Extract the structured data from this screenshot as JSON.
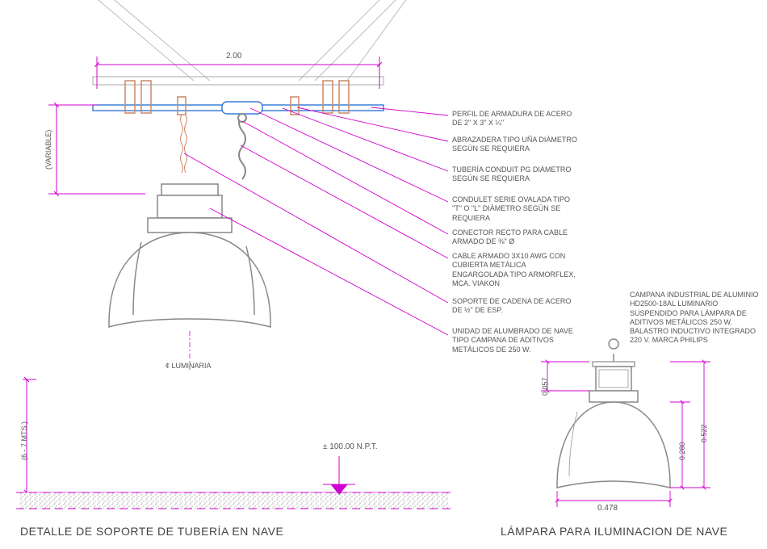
{
  "titles": {
    "left": "DETALLE DE SOPORTE DE TUBERÍA EN NAVE",
    "right": "LÁMPARA PARA ILUMINACION DE NAVE"
  },
  "dims": {
    "span": "2.00",
    "variable": "(VARIABLE)",
    "drop": "(6 - 7 MTS.)",
    "npt": "± 100.00 N.P.T.",
    "lum_label": "¢ LUMINARIA",
    "d057": "0.057",
    "d280": "0.280",
    "d522": "0.522",
    "d478": "0.478"
  },
  "annots": {
    "a1": "PERFIL DE ARMADURA DE ACERO DE 2\" X 3\" X ¼\"",
    "a2": "ABRAZADERA TIPO UÑA DIÁMETRO SEGÚN SE REQUIERA",
    "a3": "TUBERÍA CONDUIT PG DIÁMETRO SEGÚN SE REQUIERA",
    "a4": "CONDULET SERIE OVALADA TIPO \"T\" O \"L\" DIÁMETRO SEGÚN SE REQUIERA",
    "a5": "CONECTOR RECTO PARA CABLE ARMADO DE ⅜\" Ø",
    "a6": "CABLE ARMADO 3X10 AWG CON CUBIERTA METÁLICA ENGARGOLADA TIPO ARMORFLEX, MCA. VIAKON",
    "a7": "SOPORTE DE CADENA DE ACERO DE ½\" DE ESP.",
    "a8": "UNIDAD DE ALUMBRADO DE NAVE TIPO CAMPANA DE ADITIVOS METÁLICOS DE 250 W.",
    "right": "CAMPANA INDUSTRIAL DE ALUMINIO HD2500-18AL LUMINARIO SUSPENDIDO PARA LÁMPARA DE ADITIVOS METÁLICOS 250 W. BALASTRO INDUCTIVO INTEGRADO 220 V. MARCA PHILIPS"
  }
}
